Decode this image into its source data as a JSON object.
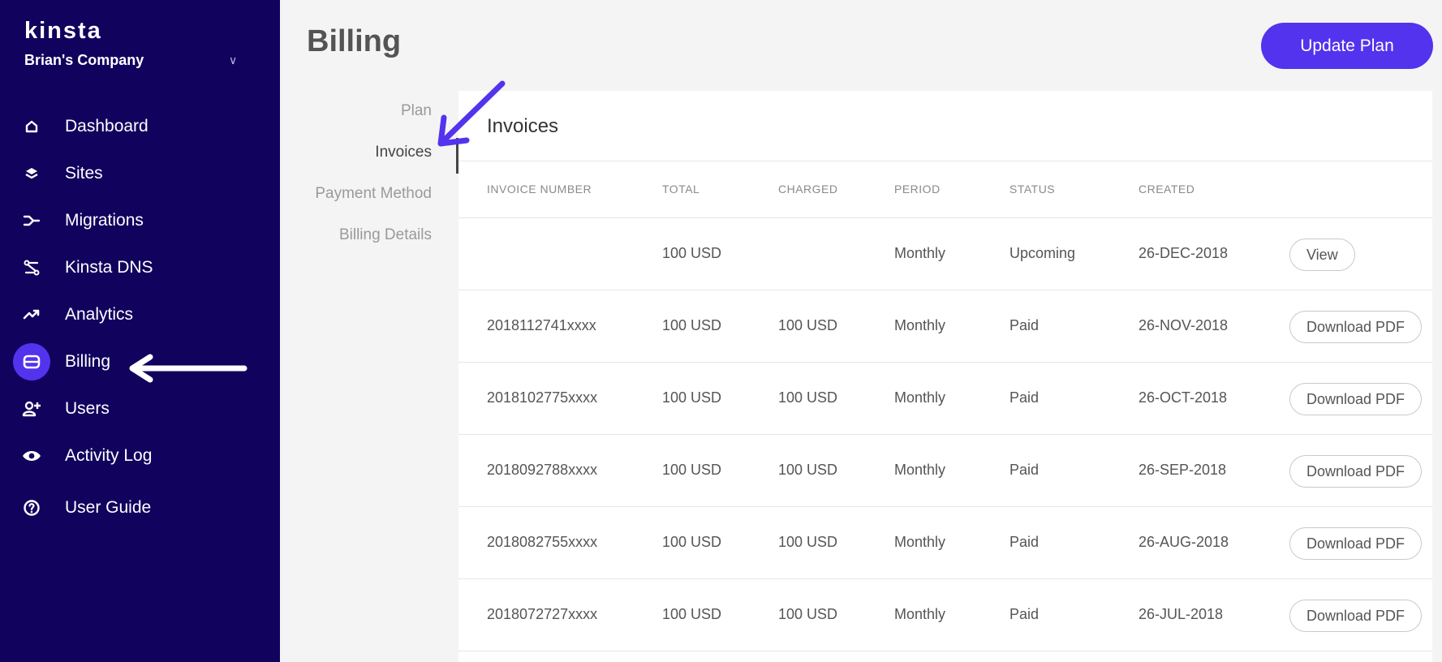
{
  "sidebar": {
    "logo": "kinsta",
    "company": "Brian's Company",
    "items": [
      {
        "label": "Dashboard",
        "icon": "home-icon"
      },
      {
        "label": "Sites",
        "icon": "layers-icon"
      },
      {
        "label": "Migrations",
        "icon": "migrations-icon"
      },
      {
        "label": "Kinsta DNS",
        "icon": "dns-icon"
      },
      {
        "label": "Analytics",
        "icon": "analytics-icon"
      },
      {
        "label": "Billing",
        "icon": "billing-icon",
        "active": true
      },
      {
        "label": "Users",
        "icon": "add-user-icon"
      },
      {
        "label": "Activity Log",
        "icon": "eye-icon"
      },
      {
        "label": "User Guide",
        "icon": "help-icon"
      }
    ]
  },
  "header": {
    "title": "Billing",
    "update_plan": "Update Plan"
  },
  "subnav": [
    {
      "label": "Plan"
    },
    {
      "label": "Invoices",
      "active": true
    },
    {
      "label": "Payment Method"
    },
    {
      "label": "Billing Details"
    }
  ],
  "invoices": {
    "title": "Invoices",
    "columns": [
      "INVOICE NUMBER",
      "TOTAL",
      "CHARGED",
      "PERIOD",
      "STATUS",
      "CREATED"
    ],
    "rows": [
      {
        "number": "",
        "total": "100 USD",
        "charged": "",
        "period": "Monthly",
        "status": "Upcoming",
        "created": "26-DEC-2018",
        "action": "View"
      },
      {
        "number": "2018112741xxxx",
        "total": "100 USD",
        "charged": "100 USD",
        "period": "Monthly",
        "status": "Paid",
        "created": "26-NOV-2018",
        "action": "Download PDF"
      },
      {
        "number": "2018102775xxxx",
        "total": "100 USD",
        "charged": "100 USD",
        "period": "Monthly",
        "status": "Paid",
        "created": "26-OCT-2018",
        "action": "Download PDF"
      },
      {
        "number": "2018092788xxxx",
        "total": "100 USD",
        "charged": "100 USD",
        "period": "Monthly",
        "status": "Paid",
        "created": "26-SEP-2018",
        "action": "Download PDF"
      },
      {
        "number": "2018082755xxxx",
        "total": "100 USD",
        "charged": "100 USD",
        "period": "Monthly",
        "status": "Paid",
        "created": "26-AUG-2018",
        "action": "Download PDF"
      },
      {
        "number": "2018072727xxxx",
        "total": "100 USD",
        "charged": "100 USD",
        "period": "Monthly",
        "status": "Paid",
        "created": "26-JUL-2018",
        "action": "Download PDF"
      }
    ]
  },
  "colors": {
    "sidebar_bg": "#11025e",
    "accent": "#5333ed"
  }
}
